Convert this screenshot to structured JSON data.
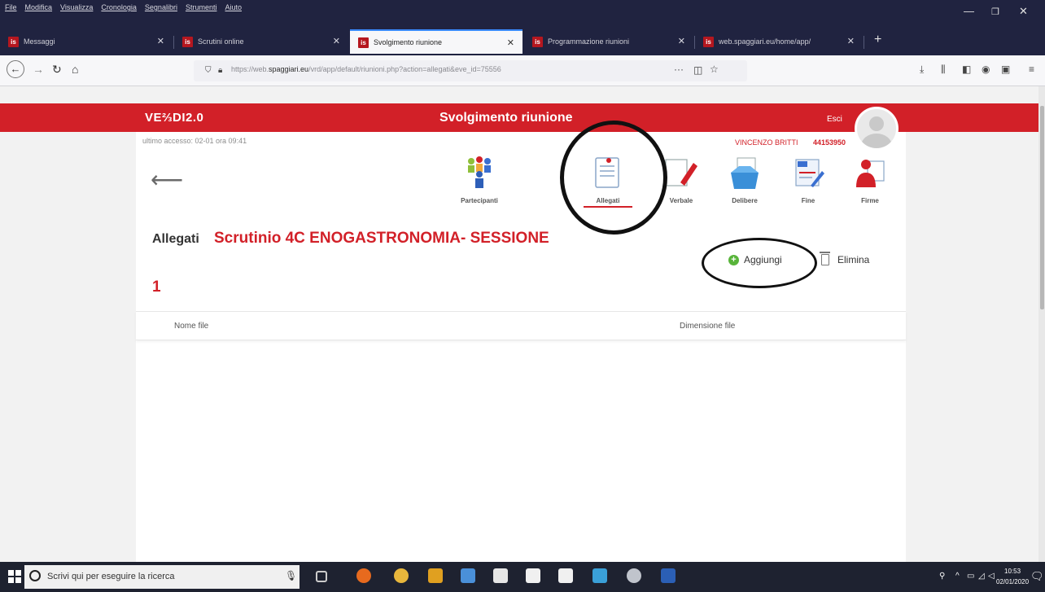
{
  "menubar": [
    "File",
    "Modifica",
    "Visualizza",
    "Cronologia",
    "Segnalibri",
    "Strumenti",
    "Aiuto"
  ],
  "tabs": [
    {
      "label": "Messaggi",
      "favicon": "is"
    },
    {
      "label": "Scrutini online",
      "favicon": "is"
    },
    {
      "label": "Svolgimento riunione",
      "favicon": "is",
      "active": true
    },
    {
      "label": "Programmazione riunioni",
      "favicon": "is"
    },
    {
      "label": "web.spaggiari.eu/home/app/",
      "favicon": "is"
    }
  ],
  "navbar": {
    "url_prefix": "https://web.",
    "url_domain": "spaggiari.eu",
    "url_path": "/vrd/app/default/riunioni.php?action=allegati&eve_id=75556",
    "page_actions": "···"
  },
  "app": {
    "logo": "VE⅔DI2.0",
    "title": "Svolgimento riunione",
    "logout_label": "Esci",
    "last_access": "ultimo accesso: 02-01 ora 09:41",
    "user_name": "VINCENZO BRITTI",
    "user_code": "44153950",
    "nav_items": [
      {
        "label": "Partecipanti",
        "icon": "participants-icon"
      },
      {
        "label": "Allegati",
        "icon": "attachments-icon",
        "active": true
      },
      {
        "label": "Verbale",
        "icon": "minutes-icon"
      },
      {
        "label": "Delibere",
        "icon": "resolutions-icon"
      },
      {
        "label": "Fine",
        "icon": "finish-icon"
      },
      {
        "label": "Firme",
        "icon": "signatures-icon"
      }
    ],
    "section_title": "Allegati",
    "meeting_name": "Scrutinio 4C ENOGASTRONOMIA- SESSIONE",
    "meeting_number": "1",
    "add_label": "Aggiungi",
    "delete_label": "Elimina",
    "table_headers": {
      "name": "Nome file",
      "size": "Dimensione file"
    }
  },
  "taskbar": {
    "search_placeholder": "Scrivi qui per eseguire la ricerca",
    "time": "10:53",
    "date": "02/01/2020"
  },
  "colors": {
    "brand_red": "#d22028",
    "chrome_dark": "#202340",
    "accent_green": "#58b43a"
  }
}
